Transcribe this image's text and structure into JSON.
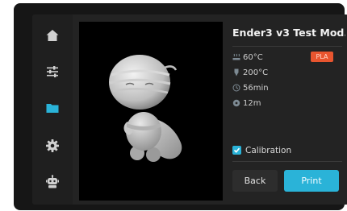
{
  "sidebar": {
    "items": [
      {
        "icon": "home-icon",
        "active": false
      },
      {
        "icon": "sliders-icon",
        "active": false
      },
      {
        "icon": "folder-icon",
        "active": true
      },
      {
        "icon": "gear-icon",
        "active": false
      },
      {
        "icon": "robot-icon",
        "active": false
      }
    ]
  },
  "file": {
    "title": "Ender3 v3 Test Mod...",
    "bed_temp": "60°C",
    "nozzle_temp": "200°C",
    "print_time": "56min",
    "filament_length": "12m",
    "material": "PLA"
  },
  "options": {
    "calibration_label": "Calibration",
    "calibration_checked": true
  },
  "buttons": {
    "back_label": "Back",
    "print_label": "Print"
  },
  "colors": {
    "accent": "#2ab3d8",
    "material_badge": "#e8552f",
    "background": "#232323"
  }
}
